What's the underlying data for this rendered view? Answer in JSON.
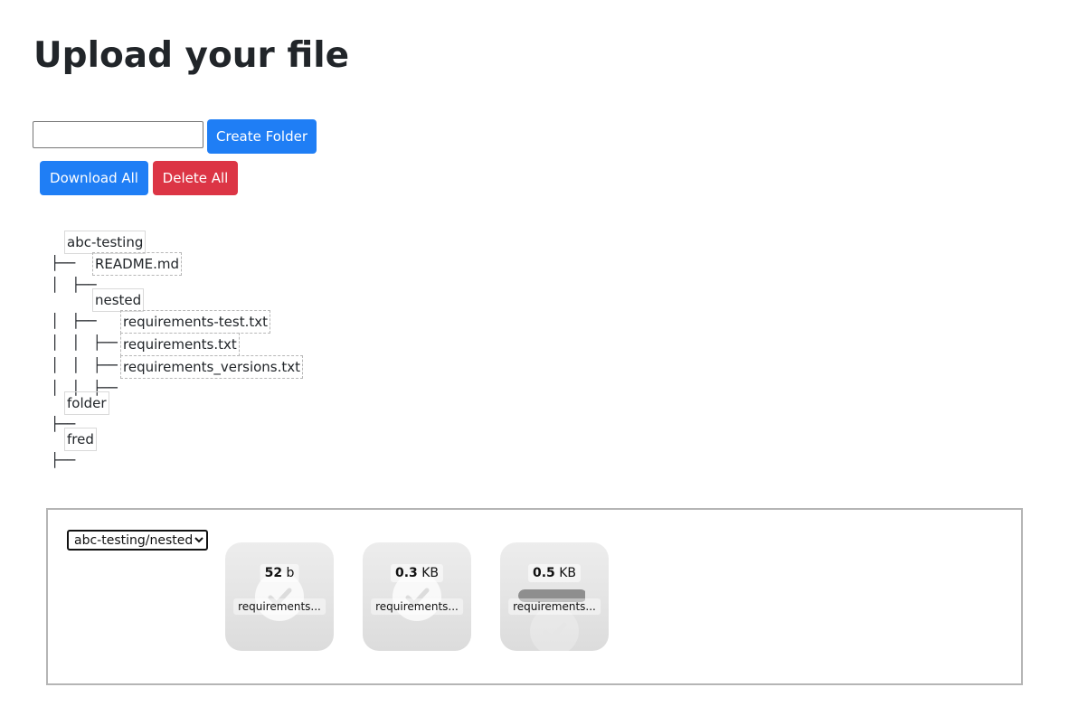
{
  "page": {
    "title": "Upload your file"
  },
  "toolbar": {
    "folder_input_value": "",
    "create_folder_label": "Create Folder",
    "download_all_label": "Download All",
    "delete_all_label": "Delete All"
  },
  "tree": {
    "abc_testing": "abc-testing",
    "readme": "README.md",
    "nested": "nested",
    "req_test": "requirements-test.txt",
    "req": "requirements.txt",
    "req_versions": "requirements_versions.txt",
    "folder": "folder",
    "fred": "fred"
  },
  "upload": {
    "selected_folder": "abc-testing/nested",
    "files": [
      {
        "size_value": "52",
        "size_unit": "b",
        "name": "requirements...",
        "progress": 1.0
      },
      {
        "size_value": "0.3",
        "size_unit": "KB",
        "name": "requirements...",
        "progress": 1.0
      },
      {
        "size_value": "0.5",
        "size_unit": "KB",
        "name": "requirements...",
        "progress": 0.97
      }
    ]
  },
  "colors": {
    "primary": "#1f7ef5",
    "danger": "#dc3545"
  }
}
